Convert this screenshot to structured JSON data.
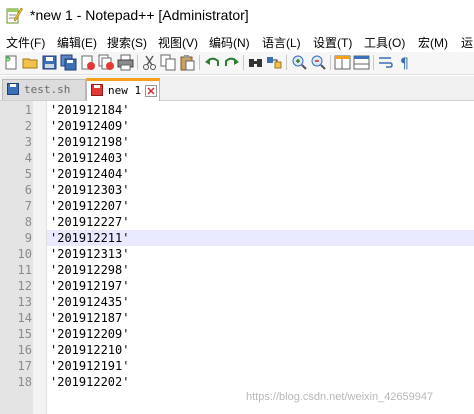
{
  "window": {
    "title": "*new 1 - Notepad++ [Administrator]"
  },
  "menubar": {
    "items": [
      {
        "label": "文件(F)"
      },
      {
        "label": "编辑(E)"
      },
      {
        "label": "搜索(S)"
      },
      {
        "label": "视图(V)"
      },
      {
        "label": "编码(N)"
      },
      {
        "label": "语言(L)"
      },
      {
        "label": "设置(T)"
      },
      {
        "label": "工具(O)"
      },
      {
        "label": "宏(M)"
      },
      {
        "label": "运"
      }
    ]
  },
  "toolbar": {
    "icons": [
      "new-file-icon",
      "open-file-icon",
      "save-icon",
      "save-all-icon",
      "close-icon",
      "close-all-icon",
      "print-icon",
      "cut-icon",
      "copy-icon",
      "paste-icon",
      "undo-icon",
      "redo-icon",
      "find-icon",
      "replace-icon",
      "zoom-in-icon",
      "zoom-out-icon",
      "sync-vertical-icon",
      "sync-horizontal-icon",
      "word-wrap-icon",
      "show-all-chars-icon"
    ]
  },
  "tabs": [
    {
      "label": "test.sh",
      "active": false,
      "color": "#6a6a6a"
    },
    {
      "label": "new 1",
      "active": true,
      "color": "#000000"
    }
  ],
  "editor": {
    "current_line": 9,
    "current_line_color": "#e8e8ff",
    "lines": [
      {
        "num": "1",
        "text": "'201912184'"
      },
      {
        "num": "2",
        "text": "'201912409'"
      },
      {
        "num": "3",
        "text": "'201912198'"
      },
      {
        "num": "4",
        "text": "'201912403'"
      },
      {
        "num": "5",
        "text": "'201912404'"
      },
      {
        "num": "6",
        "text": "'201912303'"
      },
      {
        "num": "7",
        "text": "'201912207'"
      },
      {
        "num": "8",
        "text": "'201912227'"
      },
      {
        "num": "9",
        "text": "'201912211'"
      },
      {
        "num": "10",
        "text": "'201912313'"
      },
      {
        "num": "11",
        "text": "'201912298'"
      },
      {
        "num": "12",
        "text": "'201912197'"
      },
      {
        "num": "13",
        "text": "'201912435'"
      },
      {
        "num": "14",
        "text": "'201912187'"
      },
      {
        "num": "15",
        "text": "'201912209'"
      },
      {
        "num": "16",
        "text": "'201912210'"
      },
      {
        "num": "17",
        "text": "'201912191'"
      },
      {
        "num": "18",
        "text": "'201912202'"
      }
    ]
  },
  "watermark": {
    "text": "https://blog.csdn.net/weixin_42659947"
  }
}
